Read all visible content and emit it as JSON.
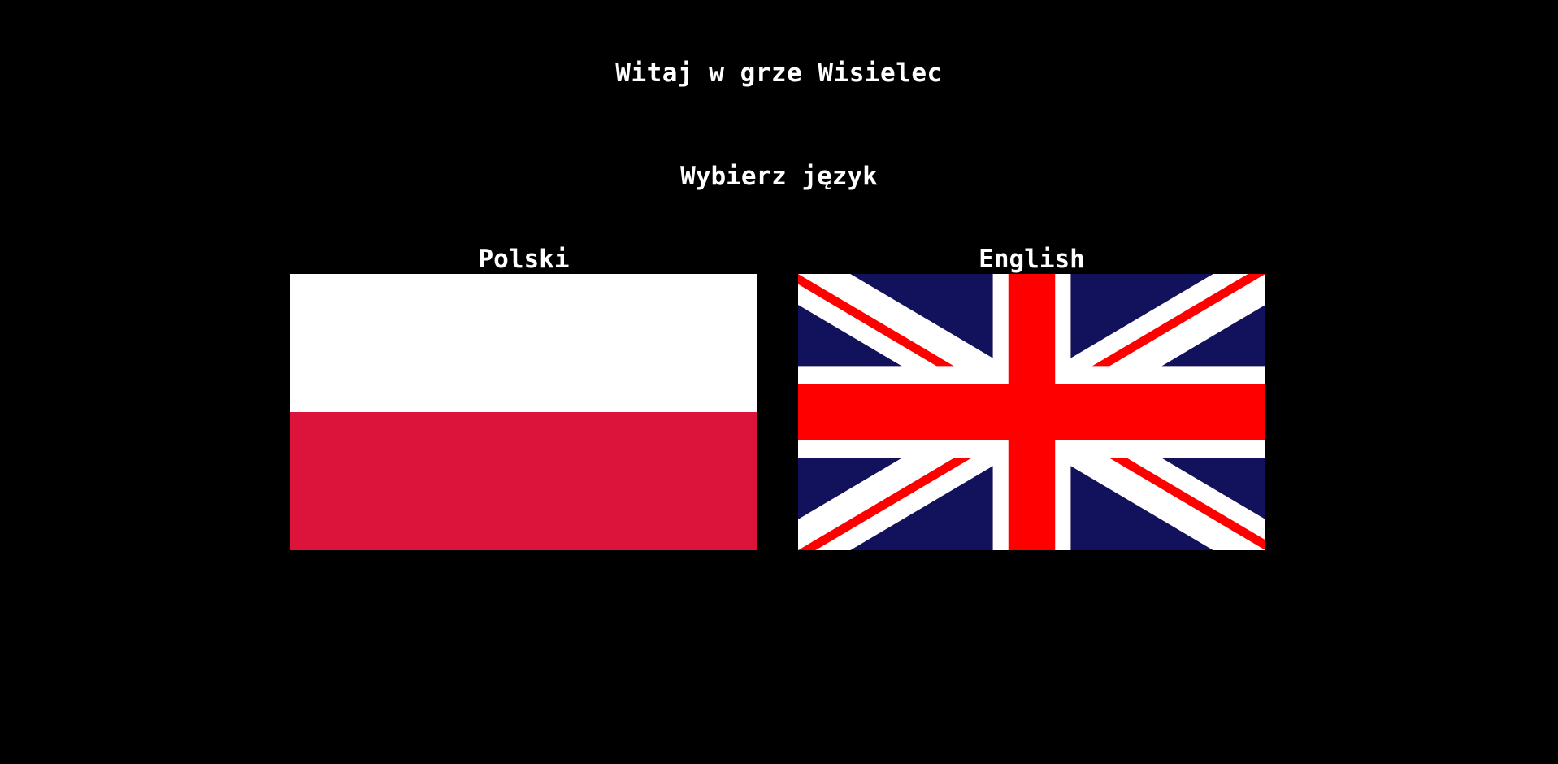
{
  "title": "Witaj w grze Wisielec",
  "subtitle": "Wybierz język",
  "languages": [
    {
      "label": "Polski",
      "flag_icon": "poland-flag-icon",
      "colors": {
        "top": "#FFFFFF",
        "bottom": "#DC143C"
      }
    },
    {
      "label": "English",
      "flag_icon": "union-jack-flag-icon",
      "colors": {
        "field": "#12125C",
        "cross": "#FF0000",
        "border": "#FFFFFF"
      }
    }
  ]
}
